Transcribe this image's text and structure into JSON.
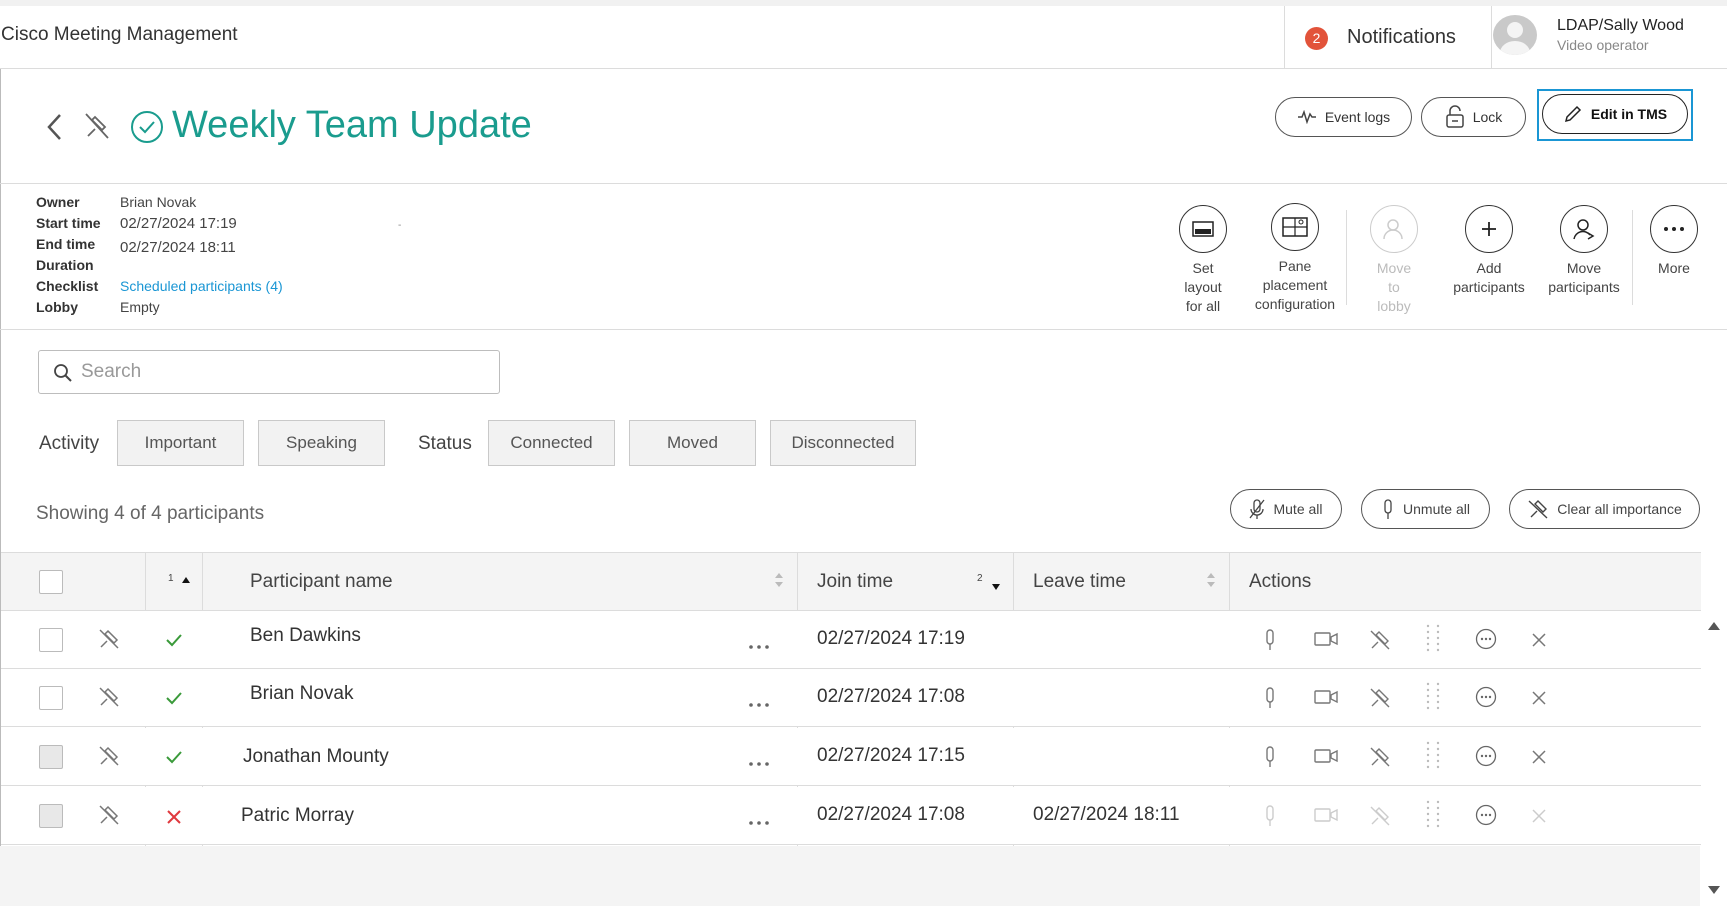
{
  "app": {
    "title": "Cisco Meeting Management"
  },
  "notifications": {
    "count": "2",
    "label": "Notifications"
  },
  "user": {
    "name": "LDAP/Sally Wood",
    "role": "Video operator"
  },
  "meeting": {
    "title": "Weekly Team Update"
  },
  "header_buttons": {
    "event_logs": "Event logs",
    "lock": "Lock",
    "edit_tms": "Edit in TMS"
  },
  "info": {
    "owner_label": "Owner",
    "owner": "Brian Novak",
    "start_label": "Start time",
    "start": "02/27/2024 17:19",
    "end_label": "End time",
    "end": "02/27/2024 18:11",
    "duration_label": "Duration",
    "duration": "-",
    "checklist_label": "Checklist",
    "checklist": "Scheduled participants (4)",
    "lobby_label": "Lobby",
    "lobby": "Empty"
  },
  "actions": {
    "set_layout": [
      "Set",
      "layout",
      "for all"
    ],
    "pane_placement": [
      "Pane",
      "placement",
      "configuration"
    ],
    "move_to_lobby": [
      "Move",
      "to",
      "lobby"
    ],
    "add_participants": [
      "Add",
      "participants"
    ],
    "move_participants": [
      "Move",
      "participants"
    ],
    "more": [
      "More"
    ]
  },
  "search": {
    "placeholder": "Search"
  },
  "filters": {
    "activity_label": "Activity",
    "important": "Important",
    "speaking": "Speaking",
    "status_label": "Status",
    "connected": "Connected",
    "moved": "Moved",
    "disconnected": "Disconnected"
  },
  "showing": "Showing 4 of 4 participants",
  "bulk": {
    "mute_all": "Mute all",
    "unmute_all": "Unmute all",
    "clear_importance": "Clear all importance"
  },
  "table": {
    "columns": {
      "status_sort": "1",
      "name": "Participant name",
      "join": "Join time",
      "join_sort": "2",
      "leave": "Leave time",
      "actions": "Actions"
    },
    "rows": [
      {
        "name": "Ben Dawkins",
        "join": "02/27/2024 17:19",
        "leave": "",
        "status": "connected"
      },
      {
        "name": "Brian Novak",
        "join": "02/27/2024 17:08",
        "leave": "",
        "status": "connected"
      },
      {
        "name": "Jonathan Mounty",
        "join": "02/27/2024 17:15",
        "leave": "",
        "status": "connected"
      },
      {
        "name": "Patric Morray",
        "join": "02/27/2024 17:08",
        "leave": "02/27/2024 18:11",
        "status": "disconnected"
      }
    ]
  },
  "colors": {
    "accent": "#1a96d4",
    "title": "#1a9c8e",
    "badge": "#e2533a",
    "connected": "#3a9a3a",
    "disconnected": "#e0393e"
  }
}
